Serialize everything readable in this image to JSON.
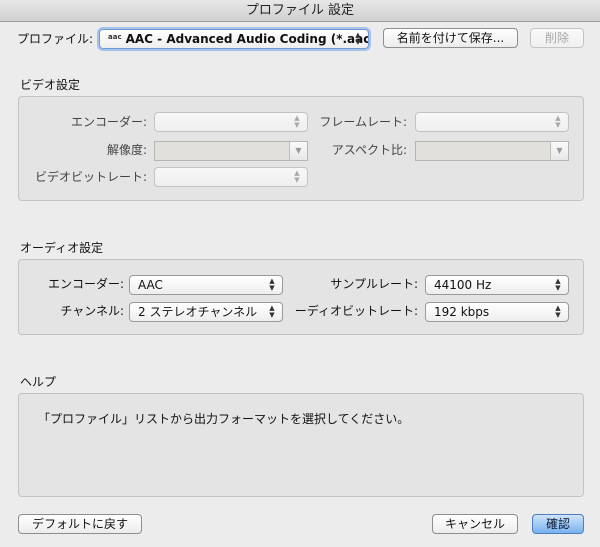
{
  "window": {
    "title": "プロファイル 設定"
  },
  "profile": {
    "label": "プロファイル:",
    "icon": "aac-format-icon",
    "icon_text": "aac",
    "value": "AAC - Advanced Audio Coding (*.aac)",
    "save_as_label": "名前を付けて保存...",
    "delete_label": "削除"
  },
  "video": {
    "section_title": "ビデオ設定",
    "encoder_label": "エンコーダー:",
    "encoder_value": "",
    "framerate_label": "フレームレート:",
    "framerate_value": "",
    "resolution_label": "解像度:",
    "resolution_value": "",
    "aspect_label": "アスペクト比:",
    "aspect_value": "",
    "bitrate_label": "ビデオビットレート:",
    "bitrate_value": ""
  },
  "audio": {
    "section_title": "オーディオ設定",
    "encoder_label": "エンコーダー:",
    "encoder_value": "AAC",
    "samplerate_label": "サンプルレート:",
    "samplerate_value": "44100 Hz",
    "channel_label": "チャンネル:",
    "channel_value": "2 ステレオチャンネル",
    "bitrate_label": "ーディオビットレート:",
    "bitrate_value": "192 kbps"
  },
  "help": {
    "section_title": "ヘルプ",
    "text": "「プロファイル」リストから出力フォーマットを選択してください。"
  },
  "footer": {
    "reset_label": "デフォルトに戻す",
    "cancel_label": "キャンセル",
    "ok_label": "確認"
  },
  "colors": {
    "window_bg": "#ececec",
    "group_bg": "#e4e4e4",
    "focus_ring": "#6ca0e5",
    "primary_button": "#78b1ef"
  }
}
